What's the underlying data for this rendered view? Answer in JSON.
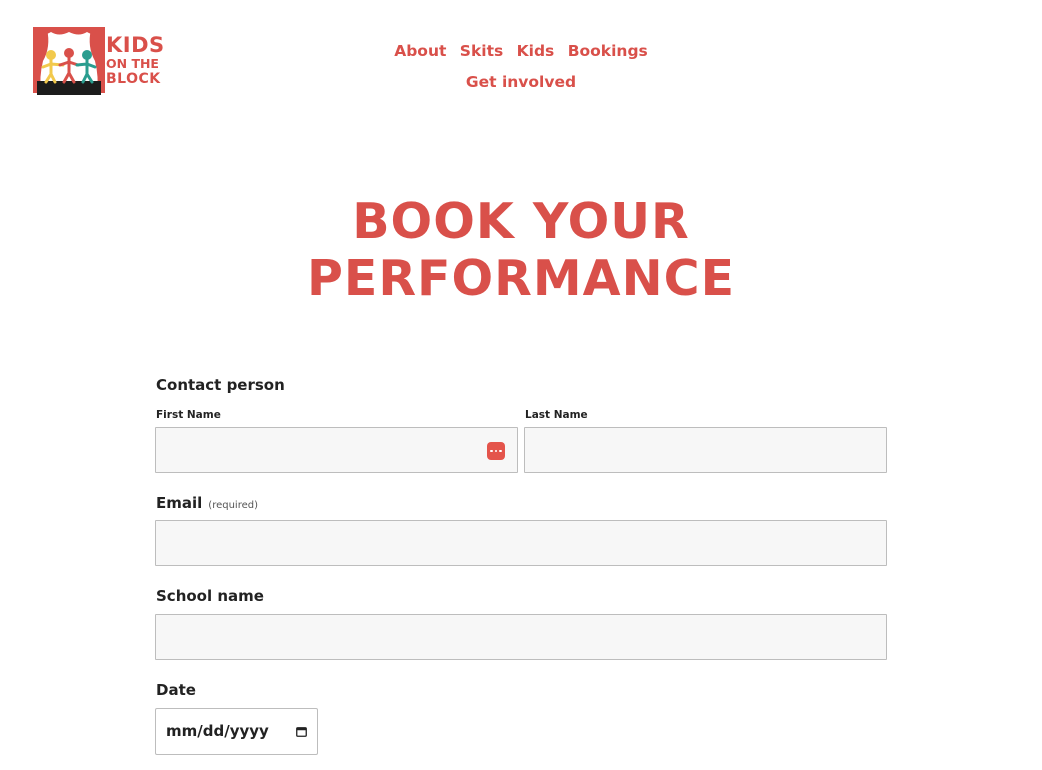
{
  "brand": {
    "logo_line1": "KIDS",
    "logo_line2": "ON THE",
    "logo_line3": "BLOCK",
    "brand_color": "#d9504a"
  },
  "nav": {
    "items": [
      {
        "label": "About"
      },
      {
        "label": "Skits"
      },
      {
        "label": "Kids"
      },
      {
        "label": "Bookings"
      },
      {
        "label": "Get involved"
      }
    ]
  },
  "page": {
    "title_line1": "BOOK YOUR",
    "title_line2": "PERFORMANCE"
  },
  "form": {
    "contact_label": "Contact person",
    "first_name_label": "First Name",
    "first_name_value": "",
    "first_name_icon": "autofill-dots-icon",
    "last_name_label": "Last Name",
    "last_name_value": "",
    "email_label": "Email",
    "email_required": "(required)",
    "email_value": "",
    "school_label": "School name",
    "school_value": "",
    "date_label": "Date",
    "date_placeholder": "mm/dd/yyyy",
    "date_icon": "calendar-icon"
  }
}
